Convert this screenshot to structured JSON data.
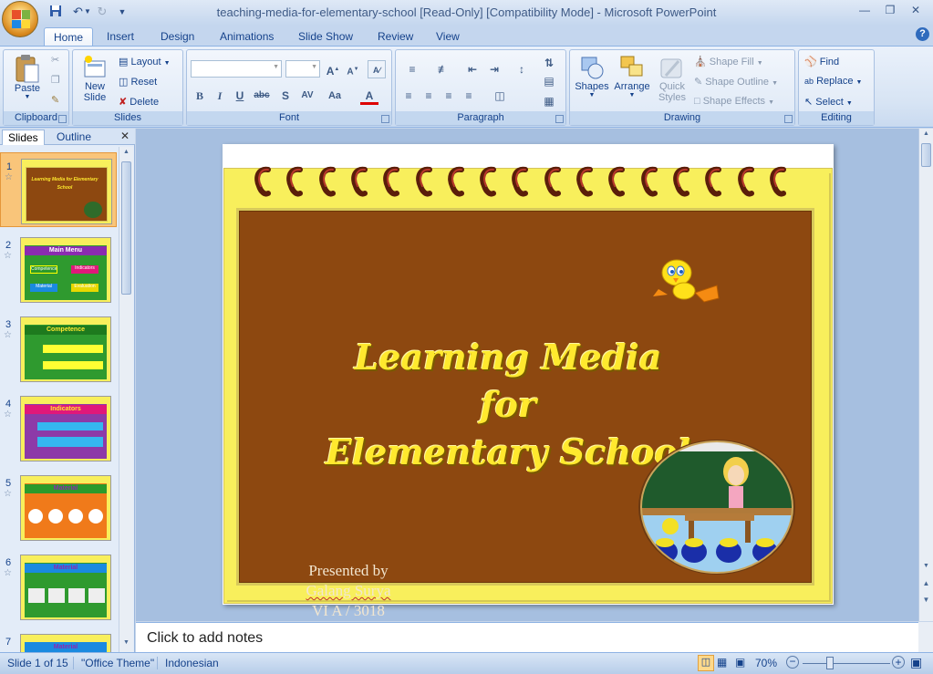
{
  "window": {
    "title": "teaching-media-for-elementary-school [Read-Only] [Compatibility Mode] - Microsoft PowerPoint",
    "controls": [
      "minimize",
      "restore",
      "close"
    ]
  },
  "ribbon_tabs": [
    "Home",
    "Insert",
    "Design",
    "Animations",
    "Slide Show",
    "Review",
    "View"
  ],
  "active_tab": "Home",
  "groups": {
    "clipboard": {
      "label": "Clipboard",
      "paste": "Paste"
    },
    "slides": {
      "label": "Slides",
      "new_slide_1": "New",
      "new_slide_2": "Slide",
      "layout": "Layout",
      "reset": "Reset",
      "delete": "Delete"
    },
    "font": {
      "label": "Font"
    },
    "paragraph": {
      "label": "Paragraph"
    },
    "drawing": {
      "label": "Drawing",
      "shapes": "Shapes",
      "arrange": "Arrange",
      "quick_styles_1": "Quick",
      "quick_styles_2": "Styles",
      "shape_fill": "Shape Fill",
      "shape_outline": "Shape Outline",
      "shape_effects": "Shape Effects"
    },
    "editing": {
      "label": "Editing",
      "find": "Find",
      "replace": "Replace",
      "select": "Select"
    }
  },
  "pane_tabs": {
    "slides": "Slides",
    "outline": "Outline"
  },
  "thumbnails": [
    {
      "num": "1",
      "title": "Learning Media for Elementary School"
    },
    {
      "num": "2",
      "title": "Main Menu",
      "items": [
        "Competence",
        "Indicators",
        "Material",
        "Evaluation"
      ]
    },
    {
      "num": "3",
      "title": "Competence"
    },
    {
      "num": "4",
      "title": "Indicators"
    },
    {
      "num": "5",
      "title": "Material"
    },
    {
      "num": "6",
      "title": "Material"
    },
    {
      "num": "7",
      "title": "Material"
    }
  ],
  "slide": {
    "title_lines": [
      "Learning Media",
      "for",
      "Elementary School"
    ],
    "presented": [
      "Presented by",
      "Galang Surya",
      "VI A / 3018"
    ]
  },
  "notes_placeholder": "Click to add notes",
  "status": {
    "slide_info": "Slide 1 of 15",
    "theme": "\"Office Theme\"",
    "language": "Indonesian",
    "zoom": "70%"
  },
  "colors": {
    "slide_paper": "#f8ef5c",
    "slide_board": "#8d4810",
    "title_text": "#ffe92e",
    "selected_thumb": "#f9c57a"
  }
}
